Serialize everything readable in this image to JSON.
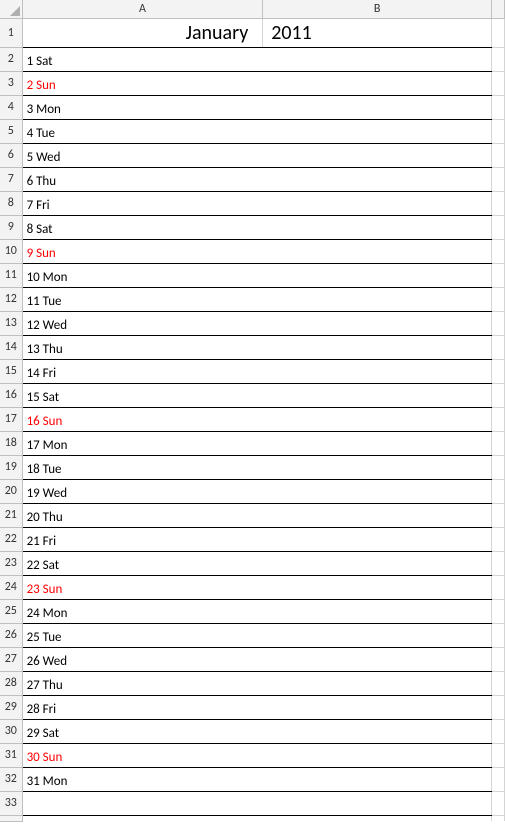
{
  "columns": [
    "A",
    "B"
  ],
  "header": {
    "month": "January",
    "year": "2011"
  },
  "days": [
    {
      "num": "1",
      "day": "Sat",
      "red": false
    },
    {
      "num": "2",
      "day": "Sun",
      "red": true
    },
    {
      "num": "3",
      "day": "Mon",
      "red": false
    },
    {
      "num": "4",
      "day": "Tue",
      "red": false
    },
    {
      "num": "5",
      "day": "Wed",
      "red": false
    },
    {
      "num": "6",
      "day": "Thu",
      "red": false
    },
    {
      "num": "7",
      "day": "Fri",
      "red": false
    },
    {
      "num": "8",
      "day": "Sat",
      "red": false
    },
    {
      "num": "9",
      "day": "Sun",
      "red": true
    },
    {
      "num": "10",
      "day": "Mon",
      "red": false
    },
    {
      "num": "11",
      "day": "Tue",
      "red": false
    },
    {
      "num": "12",
      "day": "Wed",
      "red": false
    },
    {
      "num": "13",
      "day": "Thu",
      "red": false
    },
    {
      "num": "14",
      "day": "Fri",
      "red": false
    },
    {
      "num": "15",
      "day": "Sat",
      "red": false
    },
    {
      "num": "16",
      "day": "Sun",
      "red": true
    },
    {
      "num": "17",
      "day": "Mon",
      "red": false
    },
    {
      "num": "18",
      "day": "Tue",
      "red": false
    },
    {
      "num": "19",
      "day": "Wed",
      "red": false
    },
    {
      "num": "20",
      "day": "Thu",
      "red": false
    },
    {
      "num": "21",
      "day": "Fri",
      "red": false
    },
    {
      "num": "22",
      "day": "Sat",
      "red": false
    },
    {
      "num": "23",
      "day": "Sun",
      "red": true
    },
    {
      "num": "24",
      "day": "Mon",
      "red": false
    },
    {
      "num": "25",
      "day": "Tue",
      "red": false
    },
    {
      "num": "26",
      "day": "Wed",
      "red": false
    },
    {
      "num": "27",
      "day": "Thu",
      "red": false
    },
    {
      "num": "28",
      "day": "Fri",
      "red": false
    },
    {
      "num": "29",
      "day": "Sat",
      "red": false
    },
    {
      "num": "30",
      "day": "Sun",
      "red": true
    },
    {
      "num": "31",
      "day": "Mon",
      "red": false
    }
  ],
  "emptyRows": 1,
  "partialRow": true
}
